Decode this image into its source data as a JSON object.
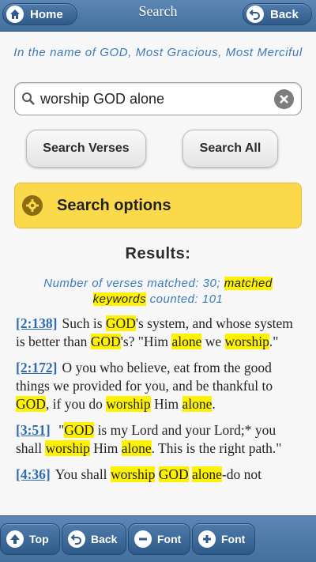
{
  "header": {
    "home_label": "Home",
    "title": "Search",
    "back_label": "Back"
  },
  "bismillah": "In the name of GOD, Most Gracious, Most Merciful",
  "search": {
    "value": "worship GOD alone",
    "clear_icon": "clear-icon"
  },
  "buttons": {
    "search_verses": "Search Verses",
    "search_all": "Search All"
  },
  "options": {
    "label": "Search options",
    "icon": "gear-icon"
  },
  "results": {
    "title": "Results:",
    "count_prefix": "Number of verses matched: 30; ",
    "count_keywords": "matched keywords",
    "count_suffix": " counted: 101"
  },
  "verses": [
    {
      "ref": "[2:138]",
      "parts": [
        {
          "t": "Such is "
        },
        {
          "t": "GOD",
          "h": true
        },
        {
          "t": "'s system, and whose system is better than "
        },
        {
          "t": "GOD",
          "h": true
        },
        {
          "t": "'s? \"Him "
        },
        {
          "t": "alone",
          "h": true
        },
        {
          "t": " we "
        },
        {
          "t": "worship",
          "h": true
        },
        {
          "t": ".\""
        }
      ]
    },
    {
      "ref": "[2:172]",
      "parts": [
        {
          "t": "O you who believe, eat from the good things we provided for you, and be thankful to "
        },
        {
          "t": "GOD",
          "h": true
        },
        {
          "t": ", if you do "
        },
        {
          "t": "worship",
          "h": true
        },
        {
          "t": " Him "
        },
        {
          "t": "alone",
          "h": true
        },
        {
          "t": "."
        }
      ]
    },
    {
      "ref": "[3:51]",
      "parts": [
        {
          "t": " \""
        },
        {
          "t": "GOD",
          "h": true
        },
        {
          "t": " is my Lord and your Lord;* you shall "
        },
        {
          "t": "worship",
          "h": true
        },
        {
          "t": " Him "
        },
        {
          "t": "alone",
          "h": true
        },
        {
          "t": ". This is the right path.\""
        }
      ]
    },
    {
      "ref": "[4:36]",
      "parts": [
        {
          "t": "You shall "
        },
        {
          "t": "worship",
          "h": true
        },
        {
          "t": " "
        },
        {
          "t": "GOD",
          "h": true
        },
        {
          "t": " "
        },
        {
          "t": "alone",
          "h": true
        },
        {
          "t": "-do not"
        }
      ]
    }
  ],
  "footer": {
    "top_label": "Top",
    "back_label": "Back",
    "font_minus_label": "Font",
    "font_plus_label": "Font"
  },
  "colors": {
    "header_bg": "#4f7aa8",
    "accent_text": "#3a7bbf",
    "highlight": "#fff200",
    "options_bg": "#fcd94a"
  }
}
